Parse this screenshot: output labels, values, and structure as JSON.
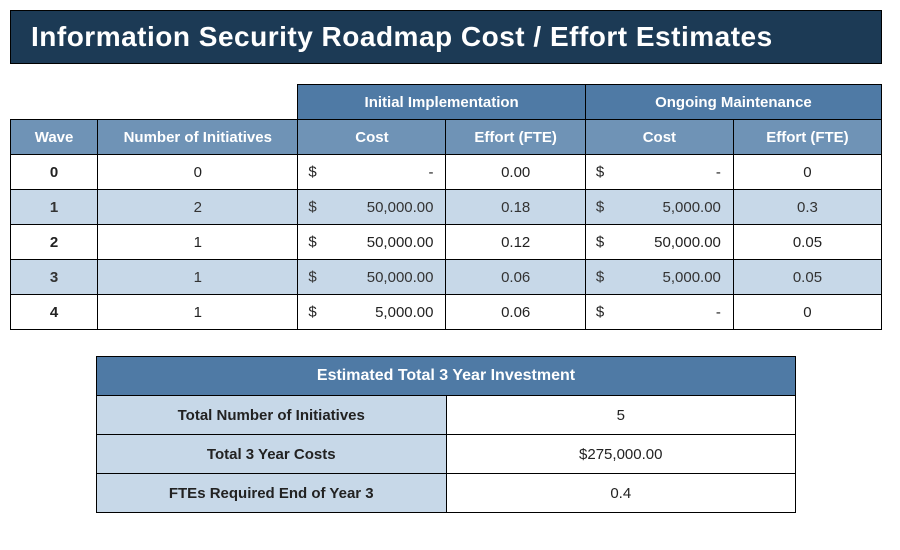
{
  "title": "Information Security Roadmap Cost / Effort Estimates",
  "cost_table": {
    "group_headers": {
      "initial": "Initial Implementation",
      "ongoing": "Ongoing Maintenance"
    },
    "sub_headers": {
      "wave": "Wave",
      "initiatives": "Number of Initiatives",
      "cost_a": "Cost",
      "effort_a": "Effort (FTE)",
      "cost_b": "Cost",
      "effort_b": "Effort (FTE)"
    },
    "rows": [
      {
        "wave": "0",
        "initiatives": "0",
        "cost_a": "-",
        "effort_a": "0.00",
        "cost_b": "-",
        "effort_b": "0"
      },
      {
        "wave": "1",
        "initiatives": "2",
        "cost_a": "50,000.00",
        "effort_a": "0.18",
        "cost_b": "5,000.00",
        "effort_b": "0.3"
      },
      {
        "wave": "2",
        "initiatives": "1",
        "cost_a": "50,000.00",
        "effort_a": "0.12",
        "cost_b": "50,000.00",
        "effort_b": "0.05"
      },
      {
        "wave": "3",
        "initiatives": "1",
        "cost_a": "50,000.00",
        "effort_a": "0.06",
        "cost_b": "5,000.00",
        "effort_b": "0.05"
      },
      {
        "wave": "4",
        "initiatives": "1",
        "cost_a": "5,000.00",
        "effort_a": "0.06",
        "cost_b": "-",
        "effort_b": "0"
      }
    ],
    "currency": "$"
  },
  "summary": {
    "title": "Estimated Total 3 Year Investment",
    "rows": [
      {
        "label": "Total Number of Initiatives",
        "value": "5"
      },
      {
        "label": "Total 3 Year Costs",
        "value": "$275,000.00"
      },
      {
        "label": "FTEs Required End of Year 3",
        "value": "0.4"
      }
    ]
  }
}
